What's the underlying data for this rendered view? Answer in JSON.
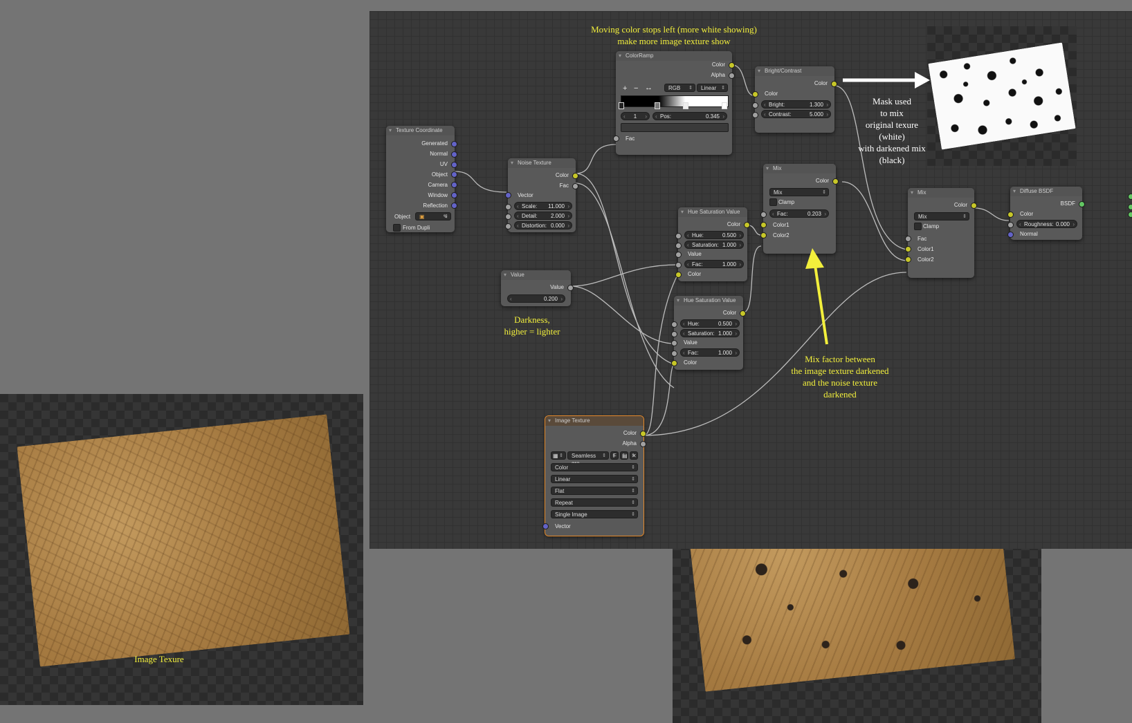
{
  "nodes": {
    "texcoord": {
      "title": "Texture Coordinate",
      "outputs": [
        "Generated",
        "Normal",
        "UV",
        "Object",
        "Camera",
        "Window",
        "Reflection"
      ],
      "object_label": "Object",
      "from_dupli": "From Dupli"
    },
    "noise": {
      "title": "Noise Texture",
      "outputs": [
        "Color",
        "Fac"
      ],
      "input_vector": "Vector",
      "fields": [
        {
          "k": "Scale:",
          "v": "11.000"
        },
        {
          "k": "Detail:",
          "v": "2.000"
        },
        {
          "k": "Distortion:",
          "v": "0.000"
        }
      ]
    },
    "colorramp": {
      "title": "ColorRamp",
      "outputs": [
        "Color",
        "Alpha"
      ],
      "plus": "+",
      "minus": "−",
      "flip": "↔",
      "mode": "RGB",
      "interp": "Linear",
      "index": "1",
      "pos_label": "Pos:",
      "pos_value": "0.345",
      "input_fac": "Fac"
    },
    "brightcontrast": {
      "title": "Bright/Contrast",
      "output": "Color",
      "input_color": "Color",
      "fields": [
        {
          "k": "Bright:",
          "v": "1.300"
        },
        {
          "k": "Contrast:",
          "v": "5.000"
        }
      ]
    },
    "mix1": {
      "title": "Mix",
      "output": "Color",
      "blend": "Mix",
      "clamp": "Clamp",
      "fac_label": "Fac:",
      "fac_value": "0.203",
      "inputs": [
        "Color1",
        "Color2"
      ]
    },
    "hsv1": {
      "title": "Hue Saturation Value",
      "output": "Color",
      "fields": [
        {
          "k": "Hue:",
          "v": "0.500"
        },
        {
          "k": "Saturation:",
          "v": "1.000"
        }
      ],
      "value_label": "Value",
      "fac": {
        "k": "Fac:",
        "v": "1.000"
      },
      "color_label": "Color"
    },
    "hsv2": {
      "title": "Hue Saturation Value",
      "output": "Color",
      "fields": [
        {
          "k": "Hue:",
          "v": "0.500"
        },
        {
          "k": "Saturation:",
          "v": "1.000"
        }
      ],
      "value_label": "Value",
      "fac": {
        "k": "Fac:",
        "v": "1.000"
      },
      "color_label": "Color"
    },
    "value": {
      "title": "Value",
      "output": "Value",
      "field_value": "0.200"
    },
    "mix2": {
      "title": "Mix",
      "output": "Color",
      "blend": "Mix",
      "clamp": "Clamp",
      "inputs": [
        "Fac",
        "Color1",
        "Color2"
      ]
    },
    "diffuse": {
      "title": "Diffuse BSDF",
      "output": "BSDF",
      "color_label": "Color",
      "roughness": {
        "k": "Roughness:",
        "v": "0.000"
      },
      "normal_label": "Normal"
    },
    "imagetex": {
      "title": "Image Texture",
      "outputs": [
        "Color",
        "Alpha"
      ],
      "image_name": "Seamless gro...",
      "fake_user": "F",
      "selects": [
        "Color",
        "Linear",
        "Flat",
        "Repeat",
        "Single Image"
      ],
      "input_vector": "Vector"
    }
  },
  "annotations": {
    "colorstops": [
      "Moving color stops left (more white showing)",
      "make more image texture show"
    ],
    "mask": [
      "Mask used",
      "to mix",
      "original texure",
      "(white)",
      "with darkened mix",
      "(black)"
    ],
    "darkness": [
      "Darkness,",
      "higher = lighter"
    ],
    "mixfactor": [
      "Mix factor between",
      "the image texture darkened",
      "and the noise texture",
      "darkened"
    ],
    "imagetexture": "Image Texure"
  },
  "colors": {
    "socket_color": "#c7c729",
    "socket_float": "#a1a1a1",
    "socket_vector": "#6363c7",
    "socket_shader": "#63c763",
    "annotation": "#f2ef3c",
    "active_node": "#e58a2b"
  }
}
